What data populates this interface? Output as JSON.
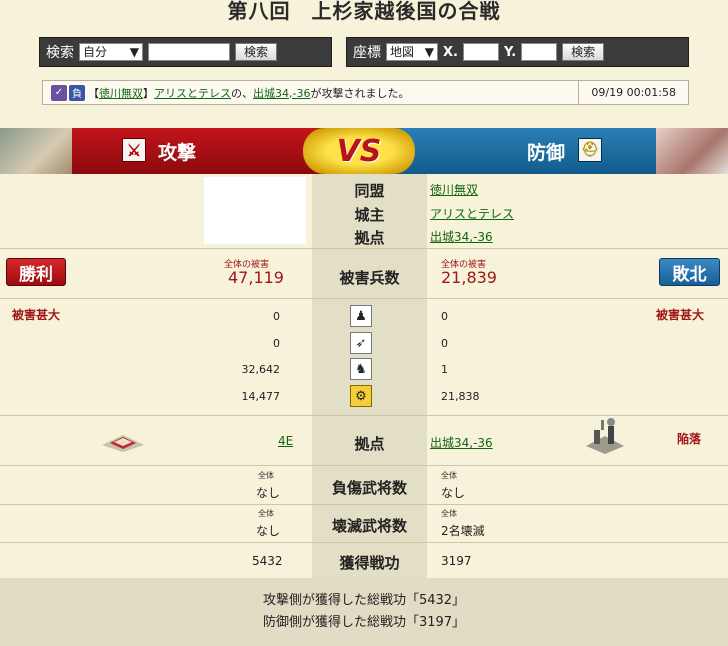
{
  "title": "第八回　上杉家越後国の合戦",
  "search_bar": {
    "label": "検索",
    "select_value": "自分",
    "button": "検索"
  },
  "coord_bar": {
    "label": "座標",
    "select_value": "地図",
    "x_label": "X.",
    "y_label": "Y.",
    "button": "検索"
  },
  "notice": {
    "icon1": "✓",
    "icon2": "負",
    "alliance_open": "【",
    "alliance": "徳川無双",
    "alliance_close": "】",
    "player": "アリスとテレス",
    "of": "の、",
    "base": "出城34,-36",
    "suffix": "が攻撃されました。",
    "date": "09/19 00:01:58"
  },
  "vs": {
    "attack_label": "攻撃",
    "defense_label": "防御",
    "vs_text": "VS"
  },
  "info_rows": {
    "alliance_label": "同盟",
    "alliance_value": "徳川無双",
    "lord_label": "城主",
    "lord_value": "アリスとテレス",
    "base_label": "拠点",
    "base_value": "出城34,-36"
  },
  "damage": {
    "label": "被害兵数",
    "win": "勝利",
    "lose": "敗北",
    "atk_caption": "全体の被害",
    "atk_total": "47,119",
    "def_caption": "全体の被害",
    "def_total": "21,839",
    "atk_status": "被害甚大",
    "def_status": "被害甚大"
  },
  "units": [
    {
      "icon": "infantry-icon",
      "glyph": "♟",
      "atk": "0",
      "def": "0"
    },
    {
      "icon": "bow-icon",
      "glyph": "➶",
      "atk": "0",
      "def": "0"
    },
    {
      "icon": "horse-icon",
      "glyph": "♞",
      "atk": "32,642",
      "def": "1"
    },
    {
      "icon": "siege-icon",
      "glyph": "⚙",
      "atk": "14,477",
      "def": "21,838"
    }
  ],
  "base_row": {
    "label": "拠点",
    "atk_value": "4E",
    "def_value": "出城34,-36",
    "def_status": "陥落"
  },
  "injured": {
    "label": "負傷武将数",
    "atk_caption": "全体",
    "atk_value": "なし",
    "def_caption": "全体",
    "def_value": "なし"
  },
  "destroyed": {
    "label": "壊滅武将数",
    "atk_caption": "全体",
    "atk_value": "なし",
    "def_caption": "全体",
    "def_value": "2名壊滅"
  },
  "merit": {
    "label": "獲得戦功",
    "atk_value": "5432",
    "def_value": "3197"
  },
  "footer": {
    "line1": "攻撃側が獲得した総戦功「5432」",
    "line2": "防御側が獲得した総戦功「3197」"
  }
}
